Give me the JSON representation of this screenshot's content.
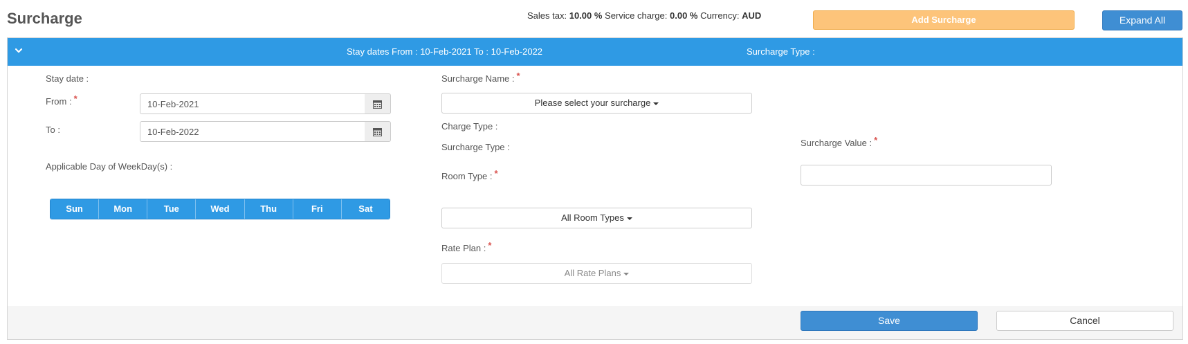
{
  "page": {
    "title": "Surcharge"
  },
  "tax_info": {
    "sales_tax_label": "Sales tax:",
    "sales_tax_value": "10.00 %",
    "service_charge_label": "Service charge:",
    "service_charge_value": "0.00 %",
    "currency_label": "Currency:",
    "currency_value": "AUD"
  },
  "toolbar": {
    "add_label": "Add Surcharge",
    "expand_label": "Expand All"
  },
  "panel": {
    "header_dates": "Stay dates From : 10-Feb-2021 To : 10-Feb-2022",
    "header_type": "Surcharge Type :",
    "chevron_icon": "chevron-down-icon"
  },
  "form": {
    "stay_date_label": "Stay date :",
    "from_label": "From :",
    "from_value": "10-Feb-2021",
    "to_label": "To :",
    "to_value": "10-Feb-2022",
    "calendar_icon": "calendar-icon",
    "weekday_label": "Applicable Day of WeekDay(s) :",
    "days": [
      "Sun",
      "Mon",
      "Tue",
      "Wed",
      "Thu",
      "Fri",
      "Sat"
    ],
    "surcharge_name_label": "Surcharge Name :",
    "surcharge_name_value": "Please select your surcharge",
    "charge_type_label": "Charge Type :",
    "surcharge_type_label": "Surcharge Type :",
    "room_type_label": "Room Type :",
    "room_type_value": "All Room Types",
    "rate_plan_label": "Rate Plan :",
    "rate_plan_value": "All Rate Plans",
    "surcharge_value_label": "Surcharge Value :",
    "surcharge_value": "",
    "required_marker": "*"
  },
  "footer": {
    "save_label": "Save",
    "cancel_label": "Cancel"
  },
  "colors": {
    "accent": "#2f9ae4",
    "primary_button": "#3f8ed3",
    "warning_button": "#fdc47a",
    "required": "#d9534f"
  }
}
